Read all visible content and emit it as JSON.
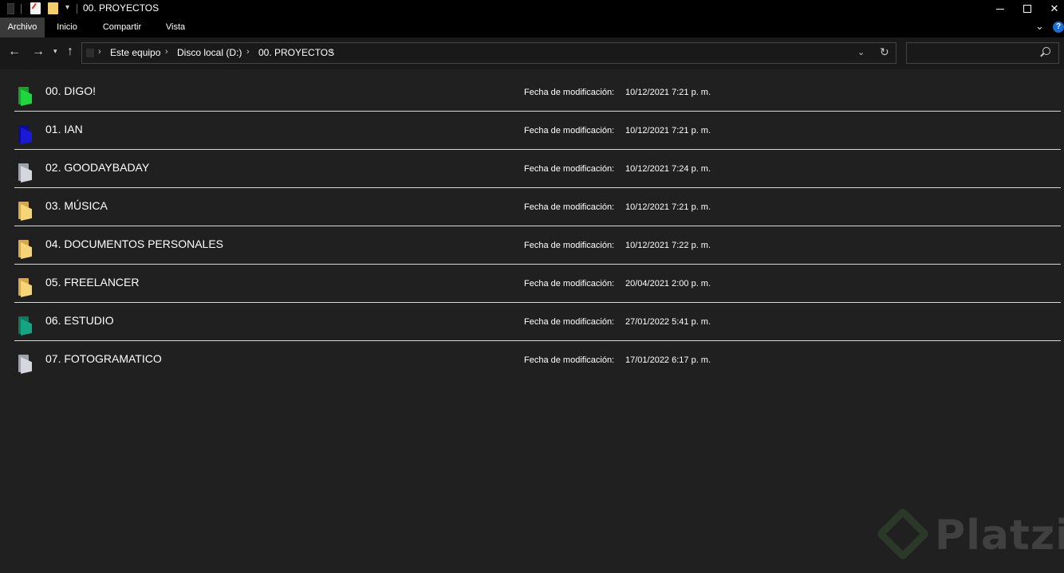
{
  "window": {
    "title": "00. PROYECTOS",
    "quick_access_dropdown": "▾"
  },
  "ribbon": {
    "tabs": [
      {
        "label": "Archivo",
        "active": true
      },
      {
        "label": "Inicio"
      },
      {
        "label": "Compartir"
      },
      {
        "label": "Vista"
      }
    ],
    "help_label": "?"
  },
  "navigation": {
    "breadcrumbs": [
      "Este equipo",
      "Disco local (D:)",
      "00. PROYECTOS"
    ],
    "separator": "›",
    "search": {
      "placeholder": "",
      "value": ""
    }
  },
  "files": {
    "modified_label": "Fecha de modificación:",
    "items": [
      {
        "name": "00. DIGO!",
        "modified": "10/12/2021 7:21 p. m.",
        "color_back": "#16a02e",
        "color_front": "#1fd63f"
      },
      {
        "name": "01. IAN",
        "modified": "10/12/2021 7:21 p. m.",
        "color_back": "#0c0c9a",
        "color_front": "#1a1ad6"
      },
      {
        "name": "02. GOODAYBADAY",
        "modified": "10/12/2021 7:24 p. m.",
        "color_back": "#9aa2ad",
        "color_front": "#d4d8de"
      },
      {
        "name": "03. MÚSICA",
        "modified": "10/12/2021 7:21 p. m.",
        "color_back": "#d9a93a",
        "color_front": "#f6d47a"
      },
      {
        "name": "04. DOCUMENTOS PERSONALES",
        "modified": "10/12/2021 7:22 p. m.",
        "color_back": "#d9a93a",
        "color_front": "#f6d47a"
      },
      {
        "name": "05. FREELANCER",
        "modified": "20/04/2021 2:00 p. m.",
        "color_back": "#d9a93a",
        "color_front": "#f6d47a"
      },
      {
        "name": "06. ESTUDIO",
        "modified": "27/01/2022 5:41 p. m.",
        "color_back": "#0d7a60",
        "color_front": "#16a583"
      },
      {
        "name": "07. FOTOGRAMATICO",
        "modified": "17/01/2022 6:17 p. m.",
        "color_back": "#9aa2ad",
        "color_front": "#d4d8de"
      }
    ]
  },
  "watermark": {
    "text": "Platzi"
  }
}
